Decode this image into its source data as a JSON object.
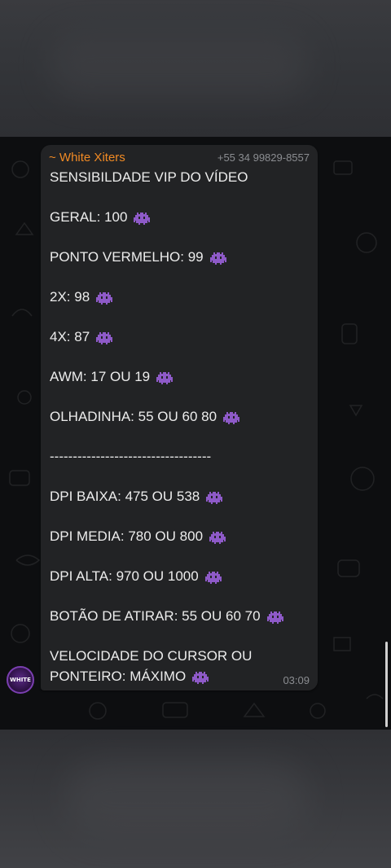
{
  "message": {
    "sender_name": "~ White Xiters",
    "sender_phone": "+55 34 99829-8557",
    "time": "03:09",
    "lines": [
      "SENSIBILDADE VIP DO VÍDEO",
      "GERAL: 100",
      "PONTO VERMELHO: 99",
      "2X: 98",
      "4X: 87",
      "AWM: 17 OU 19",
      "OLHADINHA: 55 OU 60 80",
      "-----------------------------------",
      "DPI BAIXA: 475 OU 538",
      "DPI MEDIA: 780 OU 800",
      "DPI ALTA: 970 OU 1000",
      "BOTÃO DE ATIRAR: 55 OU 60 70",
      "VELOCIDADE DO CURSOR OU",
      "PONTEIRO: MÁXIMO"
    ],
    "emoji_name": "alien-monster-icon"
  },
  "avatar": {
    "label": "WHITE"
  },
  "colors": {
    "sender_accent": "#f08a24",
    "bubble": "#222325",
    "emoji": "#8e5ac8"
  }
}
